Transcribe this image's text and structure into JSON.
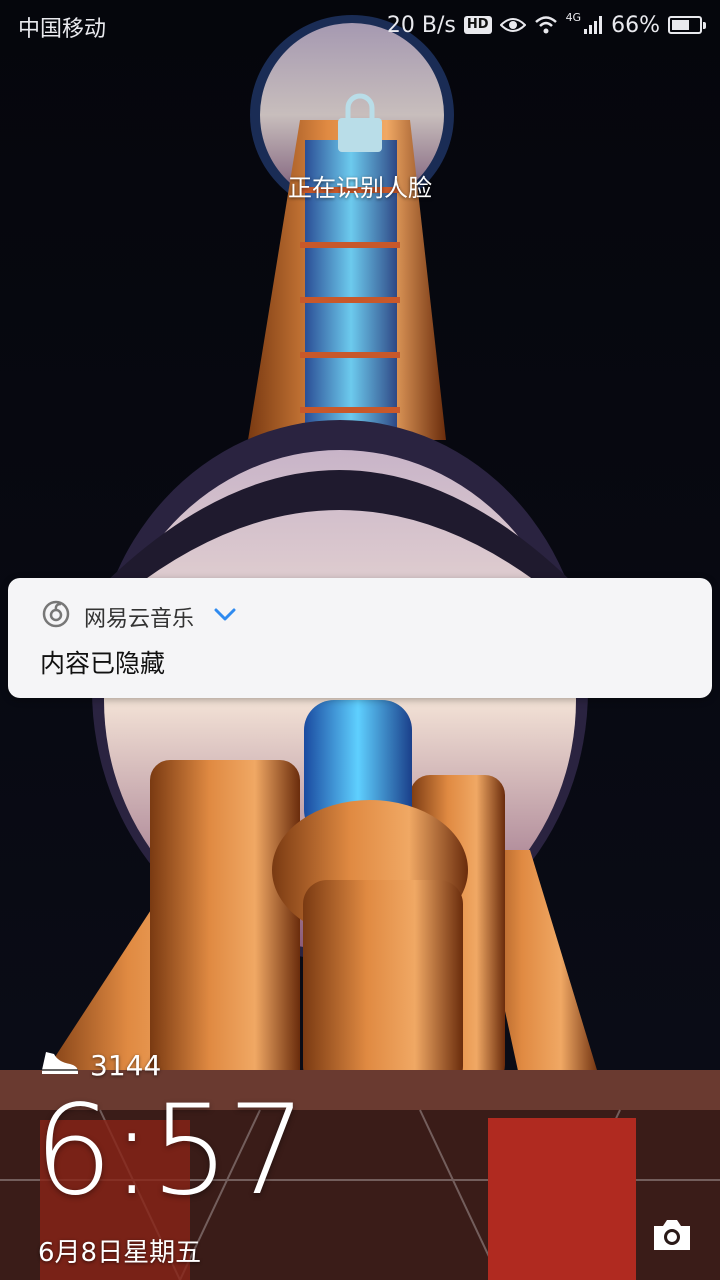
{
  "status_bar": {
    "carrier": "中国移动",
    "network_speed": "20 B/s",
    "hd_badge": "HD",
    "network_type": "4G",
    "battery_text": "66%",
    "battery_level": 0.66,
    "icons": [
      "eye-icon",
      "wifi-icon",
      "signal-icon",
      "battery-icon"
    ]
  },
  "lock": {
    "icon": "lock-icon",
    "face_status": "正在识别人脸"
  },
  "notification": {
    "app_icon": "netease-music-icon",
    "app_name": "网易云音乐",
    "expand_icon": "chevron-down-icon",
    "content": "内容已隐藏"
  },
  "steps": {
    "icon": "shoe-icon",
    "count": "3144"
  },
  "clock": {
    "time": "6:57",
    "date": "6月8日星期五"
  },
  "camera": {
    "icon": "camera-icon"
  },
  "colors": {
    "accent_blue": "#2f8bf0",
    "notification_bg": "#f5f5f7"
  }
}
